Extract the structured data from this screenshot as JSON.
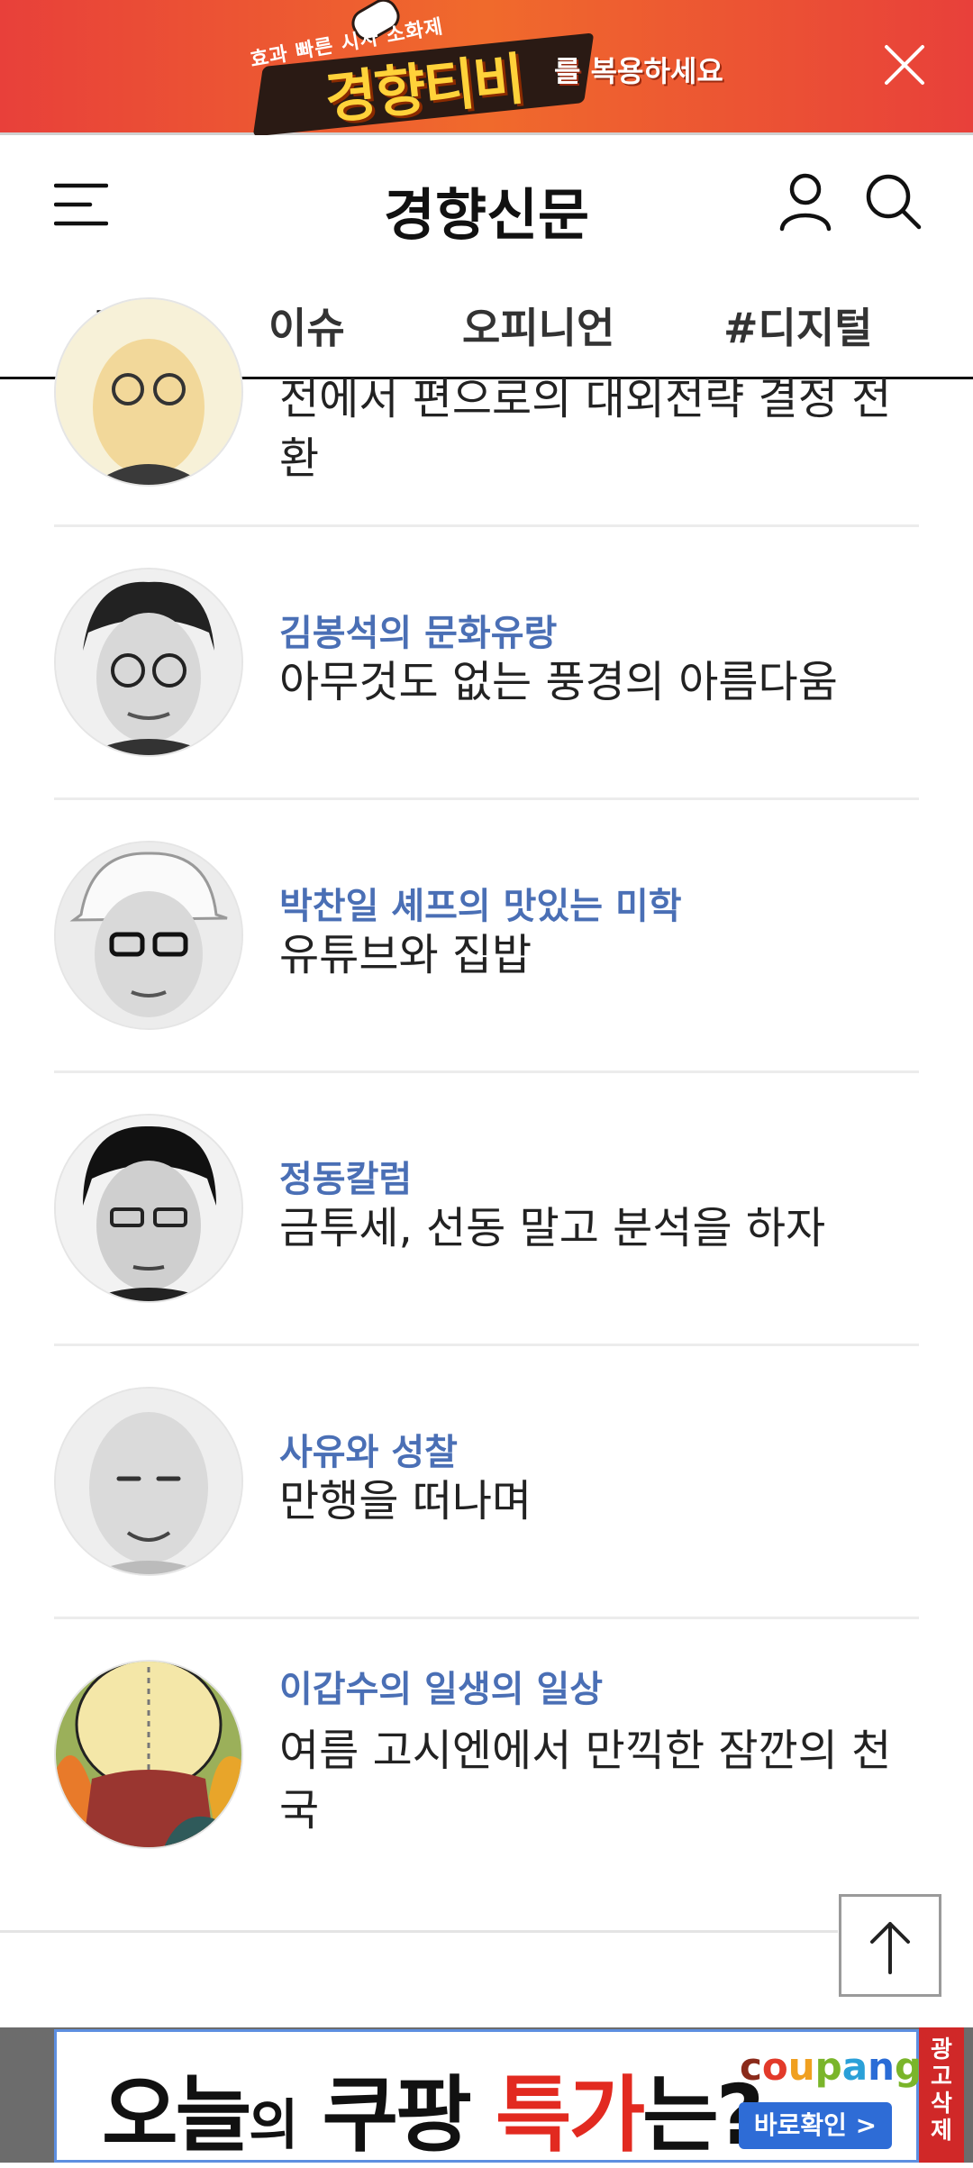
{
  "top_banner": {
    "small_text": "효과 빠른 시사 소화제",
    "brand_text": "경향티비",
    "rest_text": "를 복용하세요"
  },
  "header": {
    "logo": "경향신문"
  },
  "tabs": [
    {
      "label": "홈",
      "active": true
    },
    {
      "label": "이슈",
      "active": false
    },
    {
      "label": "오피니언",
      "active": false
    },
    {
      "label": "#디지털",
      "active": false
    }
  ],
  "articles": [
    {
      "series": "",
      "headline_line1": "전에서 편으로의 대외전략 결정 전",
      "headline_line2": "환",
      "avatar": "columnist-portrait"
    },
    {
      "series": "김봉석의 문화유랑",
      "headline_line1": "아무것도 없는 풍경의 아름다움",
      "headline_line2": "",
      "avatar": "columnist-portrait"
    },
    {
      "series": "박찬일 셰프의 맛있는 미학",
      "headline_line1": "유튜브와 집밥",
      "headline_line2": "",
      "avatar": "columnist-portrait"
    },
    {
      "series": "정동칼럼",
      "headline_line1": "금투세, 선동 말고 분석을 하자",
      "headline_line2": "",
      "avatar": "columnist-portrait"
    },
    {
      "series": "사유와 성찰",
      "headline_line1": "만행을 떠나며",
      "headline_line2": "",
      "avatar": "columnist-portrait"
    },
    {
      "series": "이갑수의 일생의 일상",
      "headline_line1": "여름 고시엔에서 만끽한 잠깐의 천",
      "headline_line2": "국",
      "avatar": "illustration"
    }
  ],
  "bottom_ad": {
    "text_part1": "오늘",
    "text_part2": "의",
    "text_part3": "쿠팡",
    "text_part4": "특가",
    "text_part5": "는?",
    "brand": "coupang",
    "button": "바로확인 >",
    "remove_label": "광고삭제"
  },
  "colors": {
    "series_blue": "#4a6fb5",
    "banner_orange": "#f06a2c",
    "ad_red": "#e22a20"
  }
}
